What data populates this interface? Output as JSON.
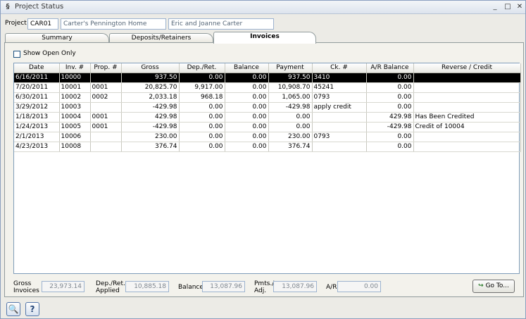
{
  "window": {
    "title": "Project Status",
    "minimize": "_",
    "maximize": "□",
    "close": "✕"
  },
  "project": {
    "label": "Project",
    "code": "CAR01",
    "name": "Carter's Pennington Home",
    "client": "Eric and Joanne Carter"
  },
  "tabs": [
    {
      "label": "Summary"
    },
    {
      "label": "Deposits/Retainers"
    },
    {
      "label": "Invoices"
    }
  ],
  "filter": {
    "show_open_only": "Show Open Only"
  },
  "columns": [
    "Date",
    "Inv. #",
    "Prop. #",
    "Gross",
    "Dep./Ret.",
    "Balance",
    "Payment",
    "Ck. #",
    "A/R Balance",
    "Reverse / Credit"
  ],
  "rows": [
    [
      "6/16/2011",
      "10000",
      "",
      "937.50",
      "0.00",
      "0.00",
      "937.50",
      "3410",
      "0.00",
      ""
    ],
    [
      "7/20/2011",
      "10001",
      "0001",
      "20,825.70",
      "9,917.00",
      "0.00",
      "10,908.70",
      "45241",
      "0.00",
      ""
    ],
    [
      "6/30/2011",
      "10002",
      "0002",
      "2,033.18",
      "968.18",
      "0.00",
      "1,065.00",
      "0793",
      "0.00",
      ""
    ],
    [
      "3/29/2012",
      "10003",
      "",
      "-429.98",
      "0.00",
      "0.00",
      "-429.98",
      "apply credit",
      "0.00",
      ""
    ],
    [
      "1/18/2013",
      "10004",
      "0001",
      "429.98",
      "0.00",
      "0.00",
      "0.00",
      "",
      "429.98",
      "Has Been Credited"
    ],
    [
      "1/24/2013",
      "10005",
      "0001",
      "-429.98",
      "0.00",
      "0.00",
      "0.00",
      "",
      "-429.98",
      "Credit of 10004"
    ],
    [
      "2/1/2013",
      "10006",
      "",
      "230.00",
      "0.00",
      "0.00",
      "230.00",
      "0793",
      "0.00",
      ""
    ],
    [
      "4/23/2013",
      "10008",
      "",
      "376.74",
      "0.00",
      "0.00",
      "376.74",
      "",
      "0.00",
      ""
    ]
  ],
  "footer": {
    "gross_label_1": "Gross",
    "gross_label_2": "Invoices",
    "gross_value": "23,973.14",
    "dep_label_1": "Dep./Ret.",
    "dep_label_2": "Applied",
    "dep_value": "10,885.18",
    "balance_label": "Balance",
    "balance_value": "13,087.96",
    "pmts_label_1": "Pmts./",
    "pmts_label_2": "Adj.",
    "pmts_value": "13,087.96",
    "ar_label": "A/R",
    "ar_value": "0.00",
    "goto_label": "Go To...",
    "goto_icon": "↪"
  },
  "bottom": {
    "search_icon": "🔍",
    "help_icon": "?"
  }
}
